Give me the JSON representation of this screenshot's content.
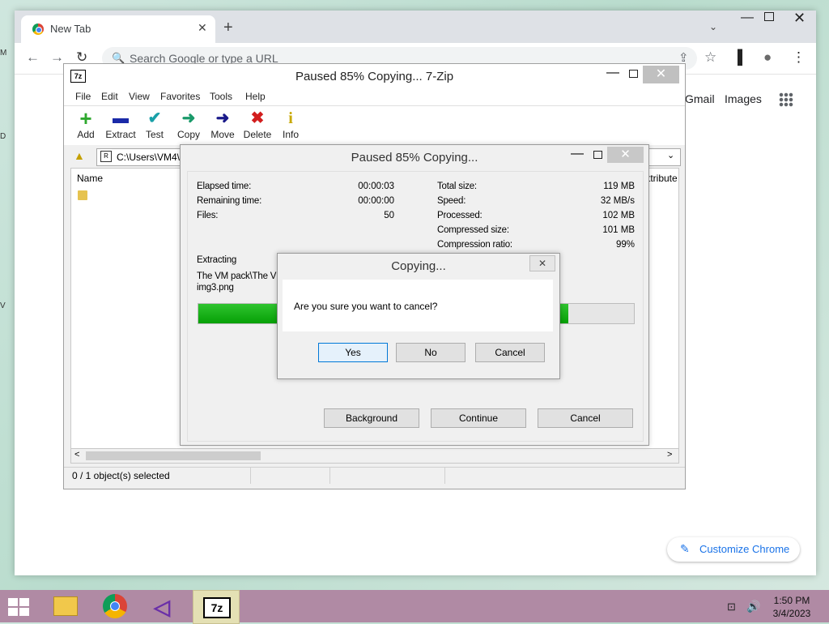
{
  "desktop": {
    "edge_glyphs": [
      "M",
      "D",
      "V"
    ]
  },
  "chrome": {
    "tab_title": "New Tab",
    "tab_close": "✕",
    "new_tab": "+",
    "tab_search": "⌄",
    "window_min": "—",
    "window_close": "✕",
    "back": "←",
    "forward": "→",
    "reload": "↻",
    "search_icon": "🔍",
    "omnibox_placeholder": "Search Google or type a URL",
    "share": "⇪",
    "bookmark": "☆",
    "sidepanel": "▌",
    "profile": "●",
    "menu": "⋮",
    "gmail": "Gmail",
    "images": "Images",
    "customize_icon": "✎",
    "customize": "Customize Chrome"
  },
  "zip": {
    "app_icon": "7z",
    "title": "Paused 85% Copying... 7-Zip",
    "min": "—",
    "close": "✕",
    "menu": [
      "File",
      "Edit",
      "View",
      "Favorites",
      "Tools",
      "Help"
    ],
    "toolbar": [
      {
        "label": "Add",
        "icon": "+",
        "color": "#2ea82e"
      },
      {
        "label": "Extract",
        "icon": "▬",
        "color": "#1a2aa8"
      },
      {
        "label": "Test",
        "icon": "✔",
        "color": "#19a0a8"
      },
      {
        "label": "Copy",
        "icon": "➜",
        "color": "#1a9a6a"
      },
      {
        "label": "Move",
        "icon": "➜",
        "color": "#1a1a8a"
      },
      {
        "label": "Delete",
        "icon": "✖",
        "color": "#d21e1e"
      },
      {
        "label": "Info",
        "icon": "i",
        "color": "#c8a800"
      }
    ],
    "path_icon": "R",
    "path": "C:\\Users\\VM4\\",
    "path_dropdown": "⌄",
    "col_name": "Name",
    "col_attr": "ttribute",
    "scroll_left": "<",
    "scroll_right": ">",
    "status": "0 / 1 object(s) selected"
  },
  "progress": {
    "title": "Paused 85% Copying...",
    "min": "—",
    "close": "✕",
    "elapsed_label": "Elapsed time:",
    "elapsed": "00:00:03",
    "remaining_label": "Remaining time:",
    "remaining": "00:00:00",
    "files_label": "Files:",
    "files": "50",
    "total_label": "Total size:",
    "total": "119 MB",
    "speed_label": "Speed:",
    "speed": "32 MB/s",
    "processed_label": "Processed:",
    "processed": "102 MB",
    "compressed_label": "Compressed size:",
    "compressed": "101 MB",
    "ratio_label": "Compression ratio:",
    "ratio": "99%",
    "action": "Extracting",
    "file_line1": "The VM pack\\The V",
    "file_line2": "img3.png",
    "progress_percent": 85,
    "btn_background": "Background",
    "btn_continue": "Continue",
    "btn_cancel": "Cancel"
  },
  "confirm": {
    "title": "Copying...",
    "close": "✕",
    "message": "Are you sure you want to cancel?",
    "yes": "Yes",
    "no": "No",
    "cancel": "Cancel"
  },
  "taskbar": {
    "app_7z": "7z",
    "app_vs": "◁",
    "tray_network": "⊡",
    "tray_volume": "🔊",
    "time": "1:50 PM",
    "date": "3/4/2023"
  }
}
